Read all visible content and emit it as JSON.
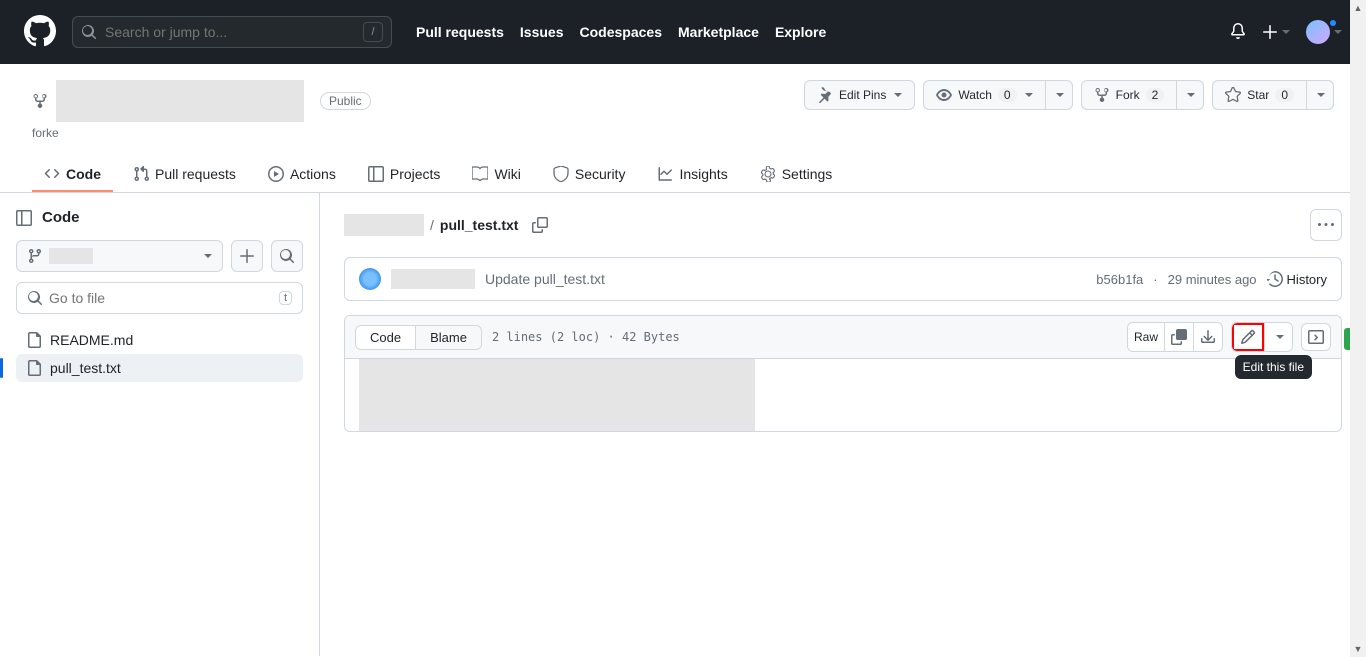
{
  "topnav": {
    "search_placeholder": "Search or jump to...",
    "slash_key": "/",
    "links": [
      "Pull requests",
      "Issues",
      "Codespaces",
      "Marketplace",
      "Explore"
    ]
  },
  "repohead": {
    "visibility": "Public",
    "forked_prefix": "forke",
    "edit_pins": "Edit Pins",
    "watch": "Watch",
    "watch_count": "0",
    "fork": "Fork",
    "fork_count": "2",
    "star": "Star",
    "star_count": "0"
  },
  "tabs": {
    "code": "Code",
    "pull_requests": "Pull requests",
    "actions": "Actions",
    "projects": "Projects",
    "wiki": "Wiki",
    "security": "Security",
    "insights": "Insights",
    "settings": "Settings"
  },
  "sidebar": {
    "title": "Code",
    "go_to_file": "Go to file",
    "go_to_file_key": "t",
    "files": [
      "README.md",
      "pull_test.txt"
    ]
  },
  "breadcrumb": {
    "sep": "/",
    "file": "pull_test.txt"
  },
  "commit": {
    "message": "Update pull_test.txt",
    "hash": "b56b1fa",
    "time": "29 minutes ago",
    "history": "History"
  },
  "file_toolbar": {
    "code": "Code",
    "blame": "Blame",
    "meta": "2 lines (2 loc) · 42 Bytes",
    "raw": "Raw"
  },
  "tooltip": {
    "edit": "Edit this file"
  }
}
